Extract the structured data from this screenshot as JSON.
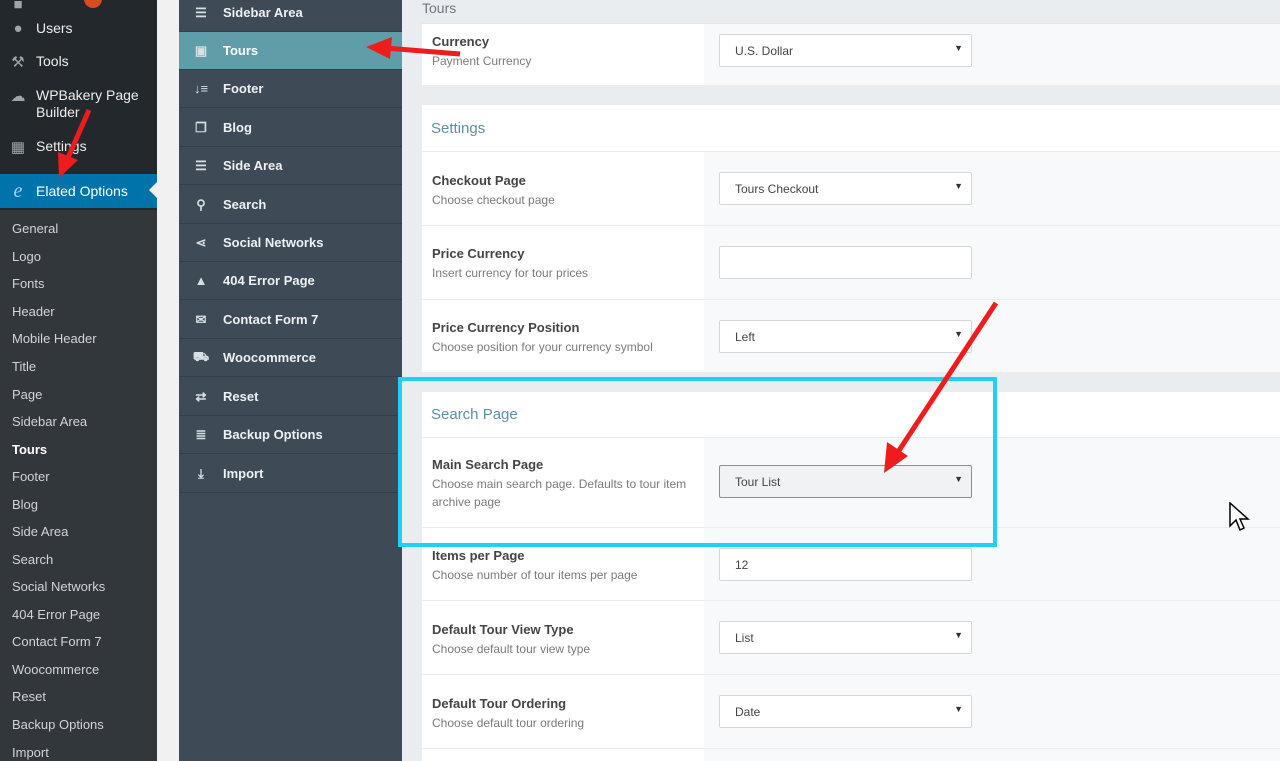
{
  "wp_menu": {
    "items": [
      {
        "label": "Users",
        "icon": "users-icon"
      },
      {
        "label": "Tools",
        "icon": "tools-icon"
      },
      {
        "label": "WPBakery Page Builder",
        "icon": "wpbakery-icon"
      },
      {
        "label": "Settings",
        "icon": "settings-icon"
      },
      {
        "label": "Elated Options",
        "icon": "elated-icon"
      }
    ],
    "submenu": [
      "General",
      "Logo",
      "Fonts",
      "Header",
      "Mobile Header",
      "Title",
      "Page",
      "Sidebar Area",
      "Tours",
      "Footer",
      "Blog",
      "Side Area",
      "Search",
      "Social Networks",
      "404 Error Page",
      "Contact Form 7",
      "Woocommerce",
      "Reset",
      "Backup Options",
      "Import"
    ],
    "current_submenu": "Tours"
  },
  "options_nav": [
    {
      "label": "Sidebar Area",
      "icon": "list-icon"
    },
    {
      "label": "Tours",
      "icon": "camera-icon"
    },
    {
      "label": "Footer",
      "icon": "footer-icon"
    },
    {
      "label": "Blog",
      "icon": "blog-icon"
    },
    {
      "label": "Side Area",
      "icon": "list-icon"
    },
    {
      "label": "Search",
      "icon": "search-icon"
    },
    {
      "label": "Social Networks",
      "icon": "share-icon"
    },
    {
      "label": "404 Error Page",
      "icon": "warning-icon"
    },
    {
      "label": "Contact Form 7",
      "icon": "mail-icon"
    },
    {
      "label": "Woocommerce",
      "icon": "cart-icon"
    },
    {
      "label": "Reset",
      "icon": "refresh-icon"
    },
    {
      "label": "Backup Options",
      "icon": "database-icon"
    },
    {
      "label": "Import",
      "icon": "download-icon"
    }
  ],
  "content": {
    "top_title": "Tours",
    "currency": {
      "title": "Currency",
      "desc": "Payment Currency",
      "value": "U.S. Dollar"
    },
    "settings_title": "Settings",
    "checkout": {
      "title": "Checkout Page",
      "desc": "Choose checkout page",
      "value": "Tours Checkout"
    },
    "price_currency": {
      "title": "Price Currency",
      "desc": "Insert currency for tour prices",
      "value": ""
    },
    "price_position": {
      "title": "Price Currency Position",
      "desc": "Choose position for your currency symbol",
      "value": "Left"
    },
    "search_title": "Search Page",
    "main_search": {
      "title": "Main Search Page",
      "desc": "Choose main search page. Defaults to tour item archive page",
      "value": "Tour List"
    },
    "items_per_page": {
      "title": "Items per Page",
      "desc": "Choose number of tour items per page",
      "value": "12"
    },
    "view_type": {
      "title": "Default Tour View Type",
      "desc": "Choose default tour view type",
      "value": "List"
    },
    "ordering": {
      "title": "Default Tour Ordering",
      "desc": "Choose default tour ordering",
      "value": "Date"
    }
  },
  "colors": {
    "wp_sidebar": "#23282d",
    "wp_active": "#0073aa",
    "options_nav": "#3e4a55",
    "options_active": "#5f9ea8",
    "highlight_box": "#1ed2f0",
    "arrow": "#ee1c1c"
  }
}
